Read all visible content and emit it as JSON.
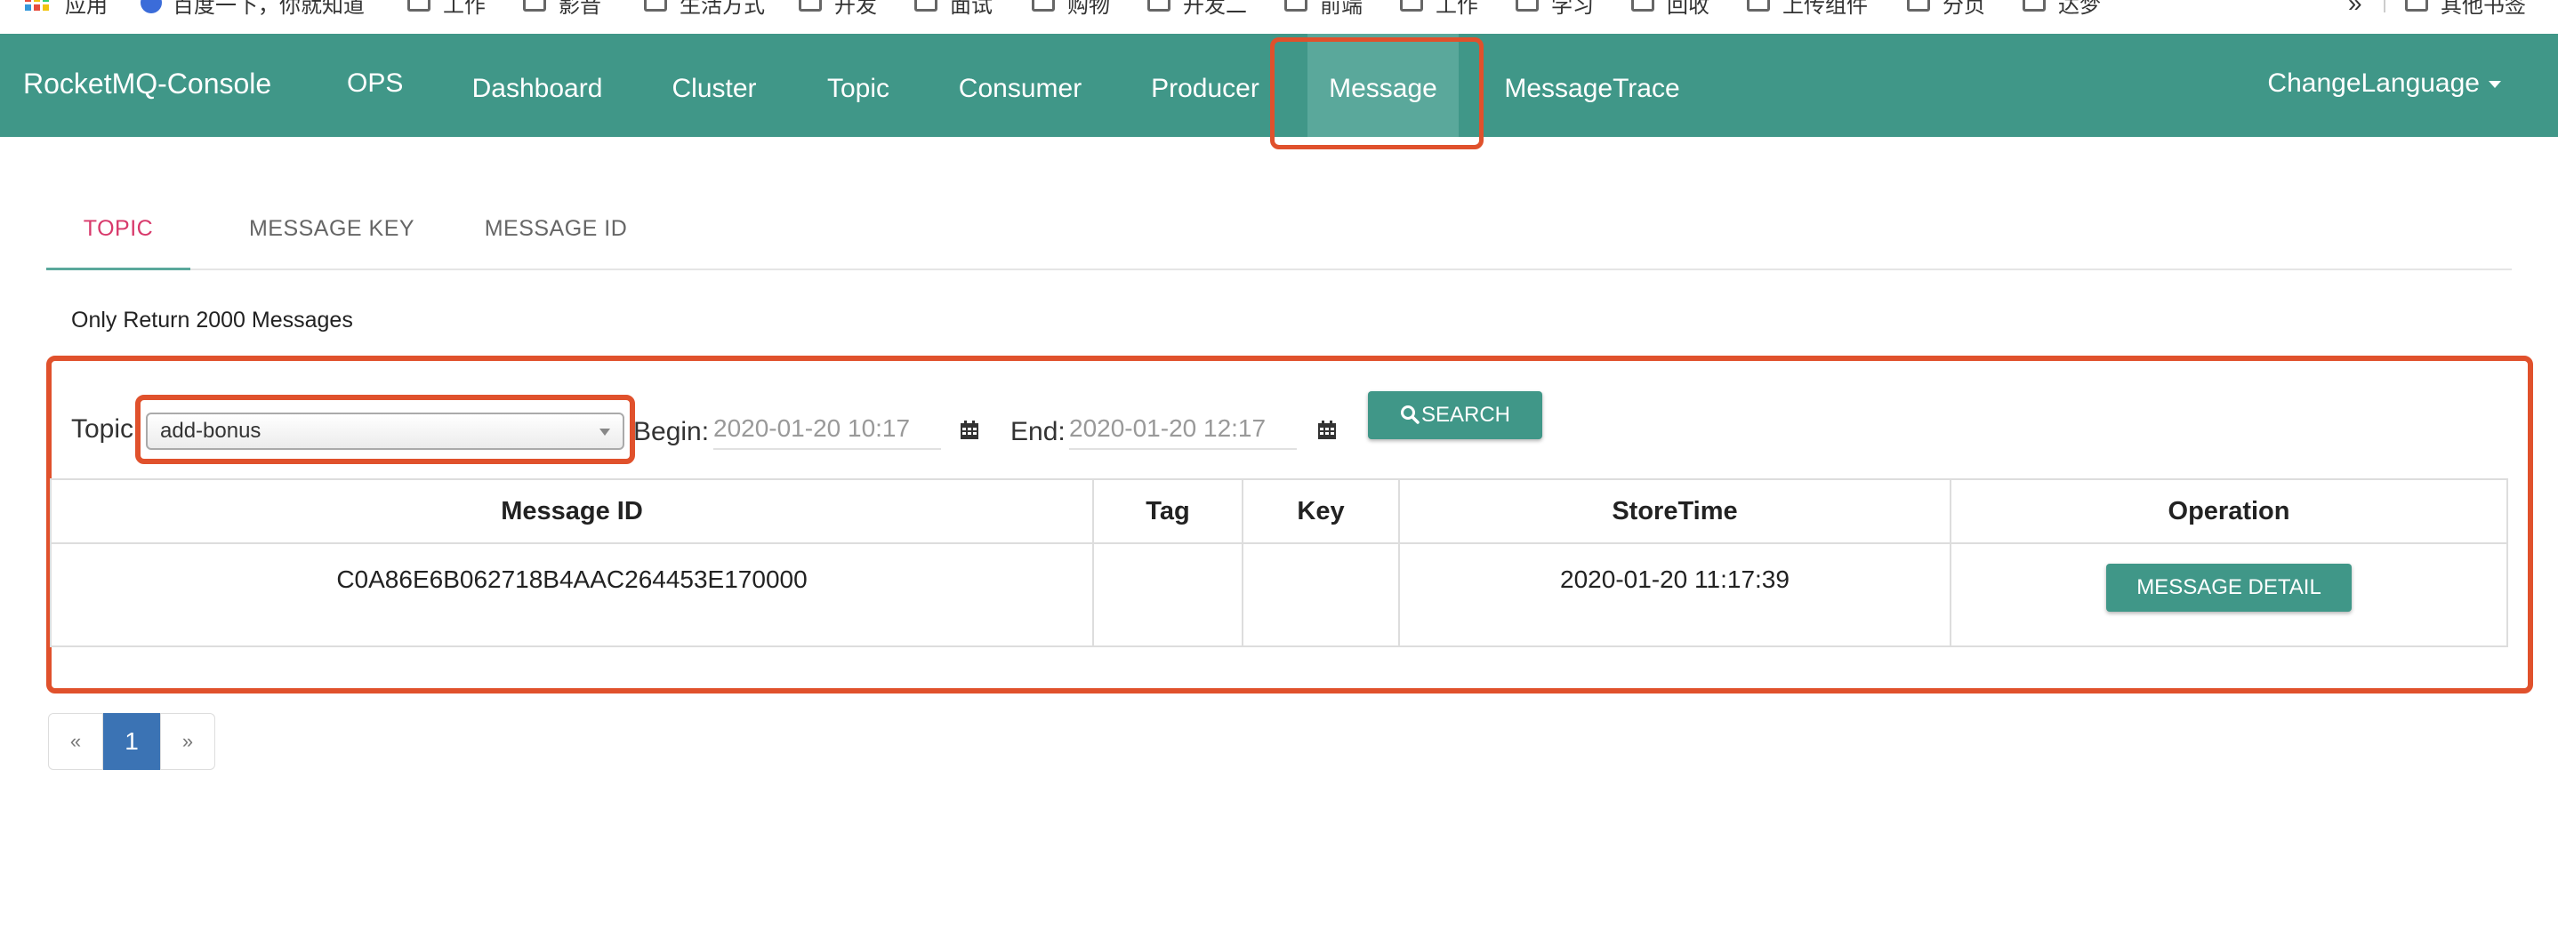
{
  "bookmarks": {
    "apps_label": "应用",
    "items": [
      "百度一下，你就知道",
      "工作",
      "影音",
      "生活方式",
      "开发",
      "面试",
      "购物",
      "开发二",
      "前端",
      "工作",
      "学习",
      "回收",
      "上传组件",
      "分页",
      "达梦"
    ],
    "other": "其他书签",
    "overflow": "»"
  },
  "navbar": {
    "brand": "RocketMQ-Console",
    "items": [
      "OPS",
      "Dashboard",
      "Cluster",
      "Topic",
      "Consumer",
      "Producer",
      "Message",
      "MessageTrace"
    ],
    "active": "Message",
    "language": "ChangeLanguage"
  },
  "tabs": {
    "topic": "TOPIC",
    "message_key": "MESSAGE KEY",
    "message_id": "MESSAGE ID",
    "active": "TOPIC"
  },
  "notice": "Only Return 2000 Messages",
  "search": {
    "topic_label": "Topic",
    "topic_value": "add-bonus",
    "begin_label": "Begin:",
    "begin_value": "2020-01-20 10:17",
    "end_label": "End:",
    "end_value": "2020-01-20 12:17",
    "button_label": "SEARCH"
  },
  "table": {
    "headers": [
      "Message ID",
      "Tag",
      "Key",
      "StoreTime",
      "Operation"
    ],
    "rows": [
      {
        "message_id": "C0A86E6B062718B4AAC264453E170000",
        "tag": "",
        "key": "",
        "store_time": "2020-01-20 11:17:39",
        "operation": "MESSAGE DETAIL"
      }
    ]
  },
  "pagination": {
    "prev": "«",
    "current": "1",
    "next": "»"
  },
  "colors": {
    "primary": "#409788",
    "highlight": "#e0512c",
    "active_tab": "#d8396b",
    "page_active": "#3b73b4"
  }
}
